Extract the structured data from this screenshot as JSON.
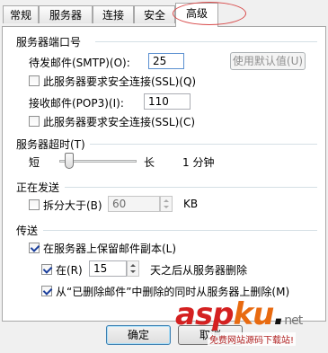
{
  "tabs": [
    {
      "label": "常规"
    },
    {
      "label": "服务器"
    },
    {
      "label": "连接"
    },
    {
      "label": "安全"
    },
    {
      "label": "高级"
    }
  ],
  "ports": {
    "title": "服务器端口号",
    "smtp_label": "待发邮件(SMTP)(O):",
    "smtp_value": "25",
    "default_button": "使用默认值(U)",
    "smtp_ssl_label": "此服务器要求安全连接(SSL)(Q)",
    "smtp_ssl_checked": false,
    "pop3_label": "接收邮件(POP3)(I):",
    "pop3_value": "110",
    "pop3_ssl_label": "此服务器要求安全连接(SSL)(C)",
    "pop3_ssl_checked": false
  },
  "timeout": {
    "title": "服务器超时(T)",
    "short_label": "短",
    "long_label": "长",
    "value_text": "1 分钟",
    "slider_fraction": 0.08
  },
  "sending": {
    "title": "正在发送",
    "split_label": "拆分大于(B)",
    "split_checked": false,
    "split_value": "60",
    "split_unit": "KB"
  },
  "delivery": {
    "title": "传送",
    "keep_copy_label": "在服务器上保留邮件副本(L)",
    "keep_copy_checked": true,
    "remove_prefix": "在(R)",
    "remove_checked": true,
    "remove_days": "15",
    "remove_suffix": "天之后从服务器删除",
    "remove_deleted_label": "从“已删除邮件”中删除的同时从服务器上删除(M)",
    "remove_deleted_checked": true
  },
  "buttons": {
    "ok": "确定",
    "cancel": "取消"
  },
  "watermark": {
    "logo_a": "asp",
    "logo_b": "ku",
    "logo_c": ".",
    "logo_net": "net",
    "subtitle": "免费网站源码下载站!"
  },
  "colors": {
    "accent_circle": "#d84a4a",
    "watermark_red": "#d42020"
  }
}
